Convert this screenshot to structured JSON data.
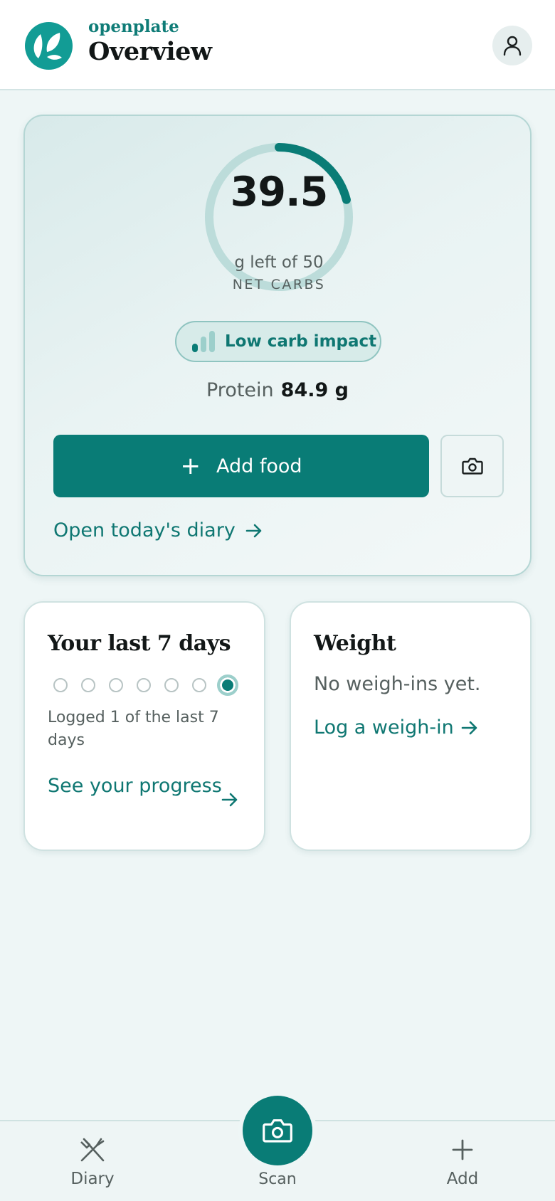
{
  "header": {
    "brand": "openplate",
    "title": "Overview",
    "logo_icon": "leaf-logo-icon",
    "profile_icon": "user-icon"
  },
  "summary": {
    "remaining_value": "39.5",
    "remaining_caption": "g left of 50",
    "metric_label": "NET CARBS",
    "progress_fraction": 0.21,
    "impact_label": "Low carb impact",
    "protein_label": "Protein",
    "protein_value": "84.9 g",
    "add_food_label": "Add food",
    "diary_link_label": "Open today's diary"
  },
  "streak_card": {
    "title": "Your last 7 days",
    "days_logged": [
      false,
      false,
      false,
      false,
      false,
      false,
      true
    ],
    "summary_text": "Logged 1 of the last 7 days",
    "link_label": "See your progress"
  },
  "weight_card": {
    "title": "Weight",
    "empty_text": "No weigh-ins yet.",
    "link_label": "Log a weigh-in"
  },
  "bottom_nav": {
    "diary_label": "Diary",
    "scan_label": "Scan",
    "add_label": "Add"
  },
  "colors": {
    "accent": "#097c76",
    "brand_teal": "#129c95",
    "ring_track": "#bcdcda",
    "background": "#eef6f6"
  }
}
